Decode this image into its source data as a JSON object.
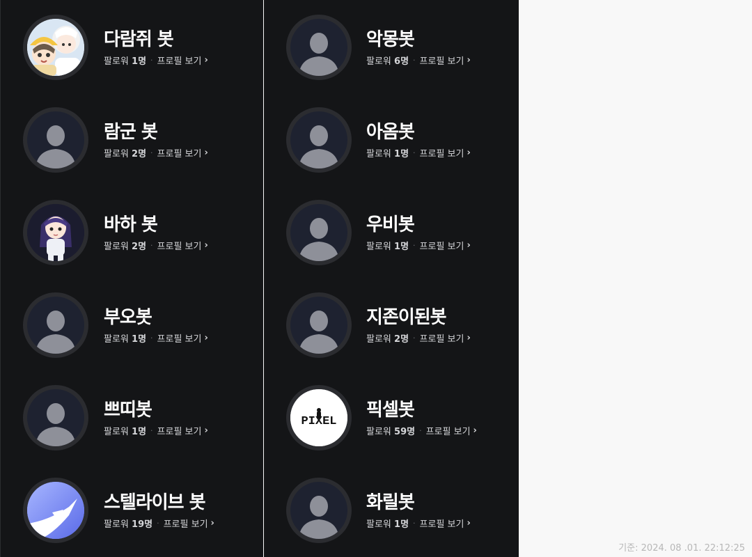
{
  "left_column": [
    {
      "name": "다람쥐 봇",
      "followers_label": "팔로워",
      "followers_count": "1명",
      "profile_link": "프로필 보기",
      "avatar": "squirrel-character-icon"
    },
    {
      "name": "람군 봇",
      "followers_label": "팔로워",
      "followers_count": "2명",
      "profile_link": "프로필 보기",
      "avatar": "default-user-icon"
    },
    {
      "name": "바하 봇",
      "followers_label": "팔로워",
      "followers_count": "2명",
      "profile_link": "프로필 보기",
      "avatar": "girl-character-icon"
    },
    {
      "name": "부오봇",
      "followers_label": "팔로워",
      "followers_count": "1명",
      "profile_link": "프로필 보기",
      "avatar": "default-user-icon"
    },
    {
      "name": "쁘띠봇",
      "followers_label": "팔로워",
      "followers_count": "1명",
      "profile_link": "프로필 보기",
      "avatar": "default-user-icon"
    },
    {
      "name": "스텔라이브 봇",
      "followers_label": "팔로워",
      "followers_count": "19명",
      "profile_link": "프로필 보기",
      "avatar": "stellive-logo-icon"
    }
  ],
  "right_column": [
    {
      "name": "악몽봇",
      "followers_label": "팔로워",
      "followers_count": "6명",
      "profile_link": "프로필 보기",
      "avatar": "default-user-icon"
    },
    {
      "name": "아옴봇",
      "followers_label": "팔로워",
      "followers_count": "1명",
      "profile_link": "프로필 보기",
      "avatar": "default-user-icon"
    },
    {
      "name": "우비봇",
      "followers_label": "팔로워",
      "followers_count": "1명",
      "profile_link": "프로필 보기",
      "avatar": "default-user-icon"
    },
    {
      "name": "지존이된봇",
      "followers_label": "팔로워",
      "followers_count": "2명",
      "profile_link": "프로필 보기",
      "avatar": "default-user-icon"
    },
    {
      "name": "픽셀봇",
      "followers_label": "팔로워",
      "followers_count": "59명",
      "profile_link": "프로필 보기",
      "avatar": "pixel-logo-icon",
      "logo_text": "PIXEL"
    },
    {
      "name": "화릴봇",
      "followers_label": "팔로워",
      "followers_count": "1명",
      "profile_link": "프로필 보기",
      "avatar": "default-user-icon"
    }
  ],
  "footer": {
    "timestamp": "기준: 2024. 08 .01. 22:12:25"
  },
  "colors": {
    "panel": "#141517",
    "page": "#f8f8f8",
    "avatar_ring": "#2b2c30",
    "avatar_bg": "#1e2230",
    "silhouette": "#8e9099"
  }
}
